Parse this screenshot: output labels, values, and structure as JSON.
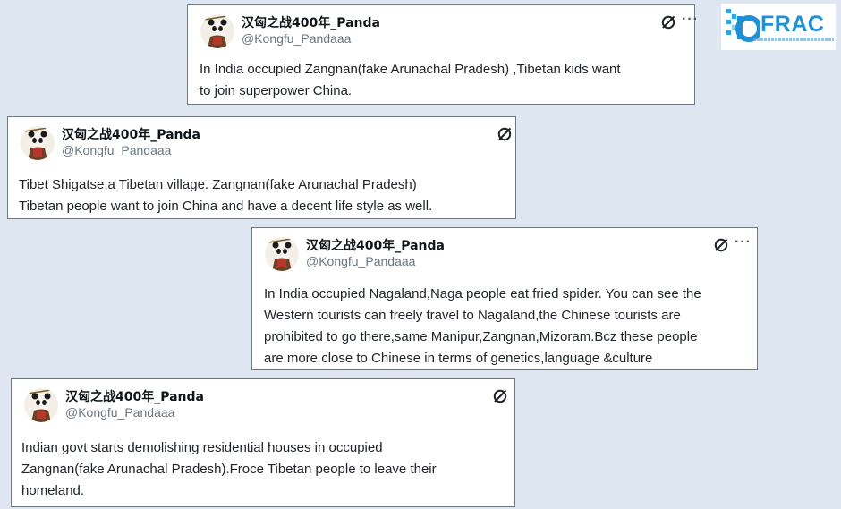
{
  "logo": {
    "text": "FRAC"
  },
  "tweets": [
    {
      "author": "汉匈之战400年_Panda",
      "handle": "@Kongfu_Pandaaa",
      "more": "···",
      "lines": [
        "In India occupied Zangnan(fake Arunachal Pradesh) ,Tibetan kids want",
        "to join superpower China."
      ]
    },
    {
      "author": "汉匈之战400年_Panda",
      "handle": "@Kongfu_Pandaaa",
      "more": "",
      "lines": [
        "Tibet Shigatse,a Tibetan village. Zangnan(fake Arunachal Pradesh)",
        "Tibetan people want to join China and have a decent life style as well."
      ]
    },
    {
      "author": "汉匈之战400年_Panda",
      "handle": "@Kongfu_Pandaaa",
      "more": "···",
      "lines": [
        "In India occupied Nagaland,Naga people eat fried spider. You can see the",
        "Western tourists can freely travel to Nagaland,the Chinese tourists are",
        "prohibited to go there,same Manipur,Zangnan,Mizoram.Bcz these people",
        "are more close to Chinese in terms of genetics,language &culture"
      ]
    },
    {
      "author": "汉匈之战400年_Panda",
      "handle": "@Kongfu_Pandaaa",
      "more": "",
      "lines": [
        "Indian govt starts demolishing residential houses in occupied",
        "Zangnan(fake Arunachal Pradesh).Froce Tibetan people to leave their",
        "homeland."
      ]
    }
  ]
}
